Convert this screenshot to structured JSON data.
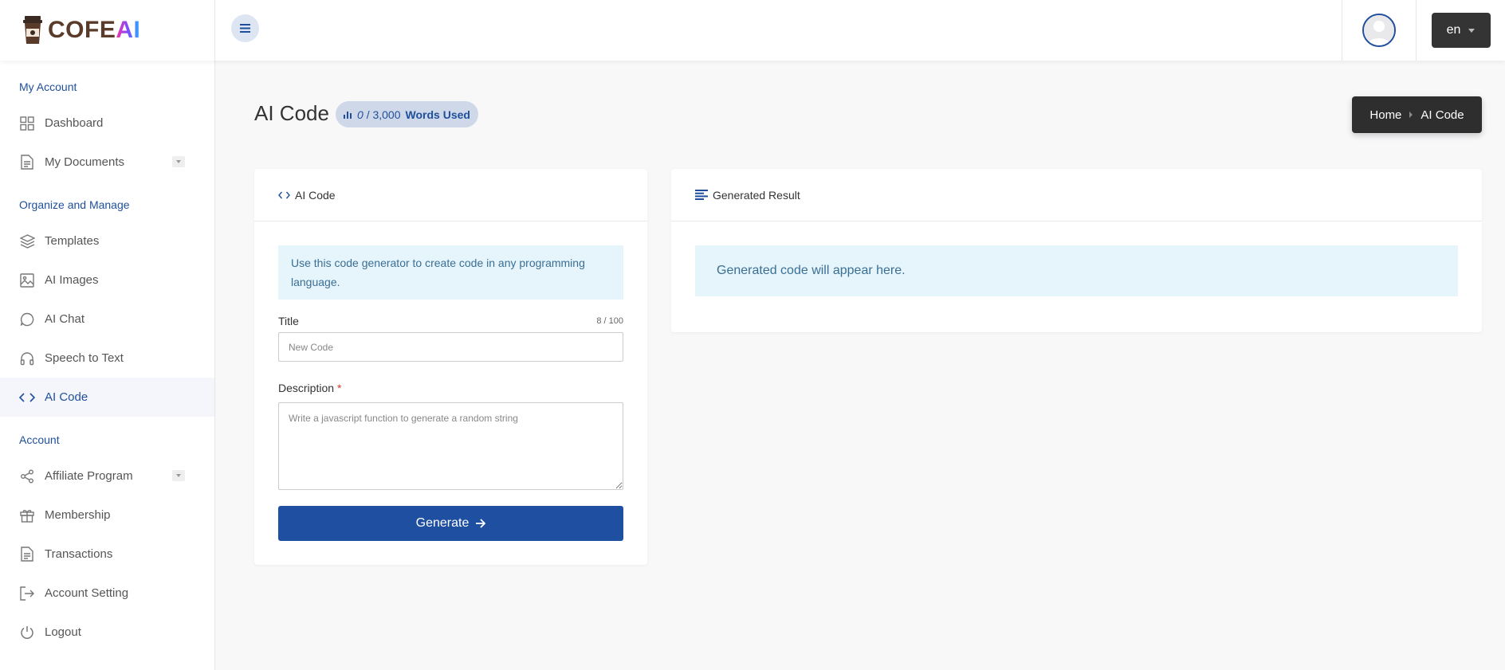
{
  "brand": {
    "name": "COFE",
    "name_accent": "AI"
  },
  "topbar": {
    "language": "en"
  },
  "sidebar": {
    "sections": [
      {
        "title": "My Account",
        "items": [
          {
            "label": "Dashboard",
            "icon": "grid-icon"
          },
          {
            "label": "My Documents",
            "icon": "document-icon",
            "dropdown": true
          }
        ]
      },
      {
        "title": "Organize and Manage",
        "items": [
          {
            "label": "Templates",
            "icon": "layers-icon"
          },
          {
            "label": "AI Images",
            "icon": "image-icon"
          },
          {
            "label": "AI Chat",
            "icon": "chat-icon"
          },
          {
            "label": "Speech to Text",
            "icon": "headphones-icon"
          },
          {
            "label": "AI Code",
            "icon": "code-icon",
            "active": true
          }
        ]
      },
      {
        "title": "Account",
        "items": [
          {
            "label": "Affiliate Program",
            "icon": "share-icon",
            "dropdown": true
          },
          {
            "label": "Membership",
            "icon": "gift-icon"
          },
          {
            "label": "Transactions",
            "icon": "document-icon"
          },
          {
            "label": "Account Setting",
            "icon": "logout-arrow-icon"
          },
          {
            "label": "Logout",
            "icon": "power-icon"
          }
        ]
      }
    ]
  },
  "page": {
    "title": "AI Code",
    "words_used": "0",
    "words_limit": "/ 3,000",
    "words_label": "Words Used",
    "breadcrumb": {
      "home": "Home",
      "current": "AI Code"
    }
  },
  "form": {
    "header": "AI Code",
    "info": "Use this code generator to create code in any programming language.",
    "title_label": "Title",
    "title_counter": "8 / 100",
    "title_placeholder": "New Code",
    "description_label": "Description",
    "description_required": "*",
    "description_placeholder": "Write a javascript function to generate a random string",
    "generate_label": "Generate"
  },
  "result": {
    "header": "Generated Result",
    "placeholder": "Generated code will appear here."
  },
  "colors": {
    "accent": "#1f4fa0",
    "info_bg": "#e6f4fb",
    "sidebar_active_bg": "#f4f6fb"
  }
}
